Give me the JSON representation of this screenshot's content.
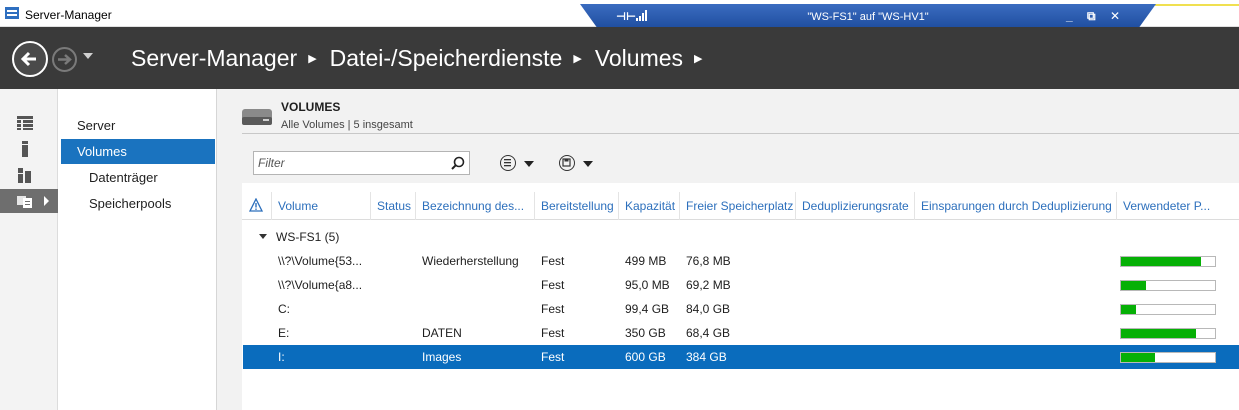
{
  "window": {
    "title": "Server-Manager",
    "remote_title": "\"WS-FS1\" auf \"WS-HV1\""
  },
  "header": {
    "breadcrumbs": [
      "Server-Manager",
      "Datei-/Speicherdienste",
      "Volumes"
    ]
  },
  "subnav": {
    "items": [
      {
        "label": "Server",
        "selected": false,
        "indent": false
      },
      {
        "label": "Volumes",
        "selected": true,
        "indent": false
      },
      {
        "label": "Datenträger",
        "selected": false,
        "indent": true
      },
      {
        "label": "Speicherpools",
        "selected": false,
        "indent": true
      }
    ]
  },
  "volumes": {
    "title": "VOLUMES",
    "subtitle": "Alle Volumes | 5 insgesamt",
    "filter_placeholder": "Filter"
  },
  "table": {
    "columns": [
      "Volume",
      "Status",
      "Bezeichnung des...",
      "Bereitstellung",
      "Kapazität",
      "Freier Speicherplatz",
      "Deduplizierungsrate",
      "Einsparungen durch Deduplizierung",
      "Verwendeter P..."
    ],
    "group": "WS-FS1 (5)",
    "rows": [
      {
        "volume": "\\\\?\\Volume{53...",
        "status": "",
        "label": "Wiederherstellung",
        "provisioning": "Fest",
        "capacity": "499 MB",
        "free": "76,8 MB",
        "used_percent": 85,
        "selected": false
      },
      {
        "volume": "\\\\?\\Volume{a8...",
        "status": "",
        "label": "",
        "provisioning": "Fest",
        "capacity": "95,0 MB",
        "free": "69,2 MB",
        "used_percent": 27,
        "selected": false
      },
      {
        "volume": "C:",
        "status": "",
        "label": "",
        "provisioning": "Fest",
        "capacity": "99,4 GB",
        "free": "84,0 GB",
        "used_percent": 16,
        "selected": false
      },
      {
        "volume": "E:",
        "status": "",
        "label": "DATEN",
        "provisioning": "Fest",
        "capacity": "350 GB",
        "free": "68,4 GB",
        "used_percent": 80,
        "selected": false
      },
      {
        "volume": "I:",
        "status": "",
        "label": "Images",
        "provisioning": "Fest",
        "capacity": "600 GB",
        "free": "384 GB",
        "used_percent": 36,
        "selected": true
      }
    ]
  },
  "colors": {
    "header_bg": "#3a3a3a",
    "selection": "#0a6cbd",
    "usage_bar": "#06b006",
    "column_header_text": "#2c6fbc"
  }
}
